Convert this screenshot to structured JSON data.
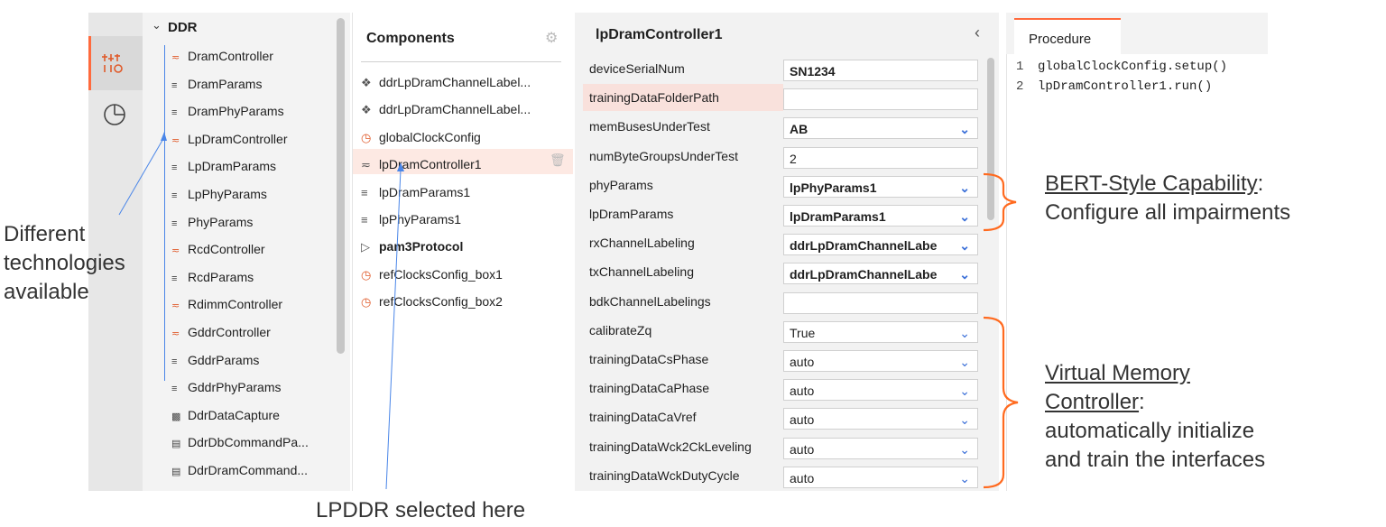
{
  "tree": {
    "group_label": "DDR",
    "items": [
      {
        "icon": "controller-icon",
        "label": "DramController"
      },
      {
        "icon": "params-icon",
        "label": "DramParams"
      },
      {
        "icon": "params-icon",
        "label": "DramPhyParams"
      },
      {
        "icon": "controller-icon",
        "label": "LpDramController"
      },
      {
        "icon": "params-icon",
        "label": "LpDramParams"
      },
      {
        "icon": "params-icon",
        "label": "LpPhyParams"
      },
      {
        "icon": "params-icon",
        "label": "PhyParams"
      },
      {
        "icon": "controller-icon",
        "label": "RcdController"
      },
      {
        "icon": "params-icon",
        "label": "RcdParams"
      },
      {
        "icon": "controller-icon",
        "label": "RdimmController"
      },
      {
        "icon": "controller-icon",
        "label": "GddrController"
      },
      {
        "icon": "params-icon",
        "label": "GddrParams"
      },
      {
        "icon": "params-icon",
        "label": "GddrPhyParams"
      },
      {
        "icon": "capture-icon",
        "label": "DdrDataCapture"
      },
      {
        "icon": "list-icon",
        "label": "DdrDbCommandPa..."
      },
      {
        "icon": "list-icon",
        "label": "DdrDramCommand..."
      }
    ]
  },
  "components": {
    "title": "Components",
    "items": [
      {
        "icon": "label-icon",
        "label": "ddrLpDramChannelLabel..."
      },
      {
        "icon": "label-icon",
        "label": "ddrLpDramChannelLabel..."
      },
      {
        "icon": "clock-icon",
        "label": "globalClockConfig"
      },
      {
        "icon": "controller-icon",
        "label": "lpDramController1"
      },
      {
        "icon": "params-icon",
        "label": "lpDramParams1"
      },
      {
        "icon": "params-icon",
        "label": "lpPhyParams1"
      },
      {
        "icon": "protocol-icon",
        "label": "pam3Protocol"
      },
      {
        "icon": "clock-icon",
        "label": "refClocksConfig_box1"
      },
      {
        "icon": "clock-icon",
        "label": "refClocksConfig_box2"
      }
    ]
  },
  "properties": {
    "title": "lpDramController1",
    "rows": [
      {
        "label": "deviceSerialNum",
        "value": "SN1234"
      },
      {
        "label": "trainingDataFolderPath",
        "value": ""
      },
      {
        "label": "memBusesUnderTest",
        "value": "AB"
      },
      {
        "label": "numByteGroupsUnderTest",
        "value": "2"
      },
      {
        "label": "phyParams",
        "value": "lpPhyParams1"
      },
      {
        "label": "lpDramParams",
        "value": "lpDramParams1"
      },
      {
        "label": "rxChannelLabeling",
        "value": "ddrLpDramChannelLabe"
      },
      {
        "label": "txChannelLabeling",
        "value": "ddrLpDramChannelLabe"
      },
      {
        "label": "bdkChannelLabelings",
        "value": ""
      },
      {
        "label": "calibrateZq",
        "value": "True"
      },
      {
        "label": "trainingDataCsPhase",
        "value": "auto"
      },
      {
        "label": "trainingDataCaPhase",
        "value": "auto"
      },
      {
        "label": "trainingDataCaVref",
        "value": "auto"
      },
      {
        "label": "trainingDataWck2CkLeveling",
        "value": "auto"
      },
      {
        "label": "trainingDataWckDutyCycle",
        "value": "auto"
      }
    ]
  },
  "procedure": {
    "tab": "Procedure",
    "lines": [
      {
        "n": "1",
        "code": "globalClockConfig.setup()"
      },
      {
        "n": "2",
        "code": "lpDramController1.run()"
      }
    ]
  },
  "annotations": {
    "left_1": "Different",
    "left_2": "technologies",
    "left_3": "available",
    "bottom": "LPDDR selected here",
    "bert_title": "BERT-Style Capability",
    "bert_colon": ":",
    "bert_body": "Configure all impairments",
    "vmc_title_1": "Virtual Memory",
    "vmc_title_2": "Controller",
    "vmc_colon": ":",
    "vmc_body_1": "automatically initialize",
    "vmc_body_2": "and train the interfaces"
  },
  "colors": {
    "accent": "#ff6a3d",
    "bracket": "#ff6a1f",
    "arrow": "#4a86e8"
  }
}
